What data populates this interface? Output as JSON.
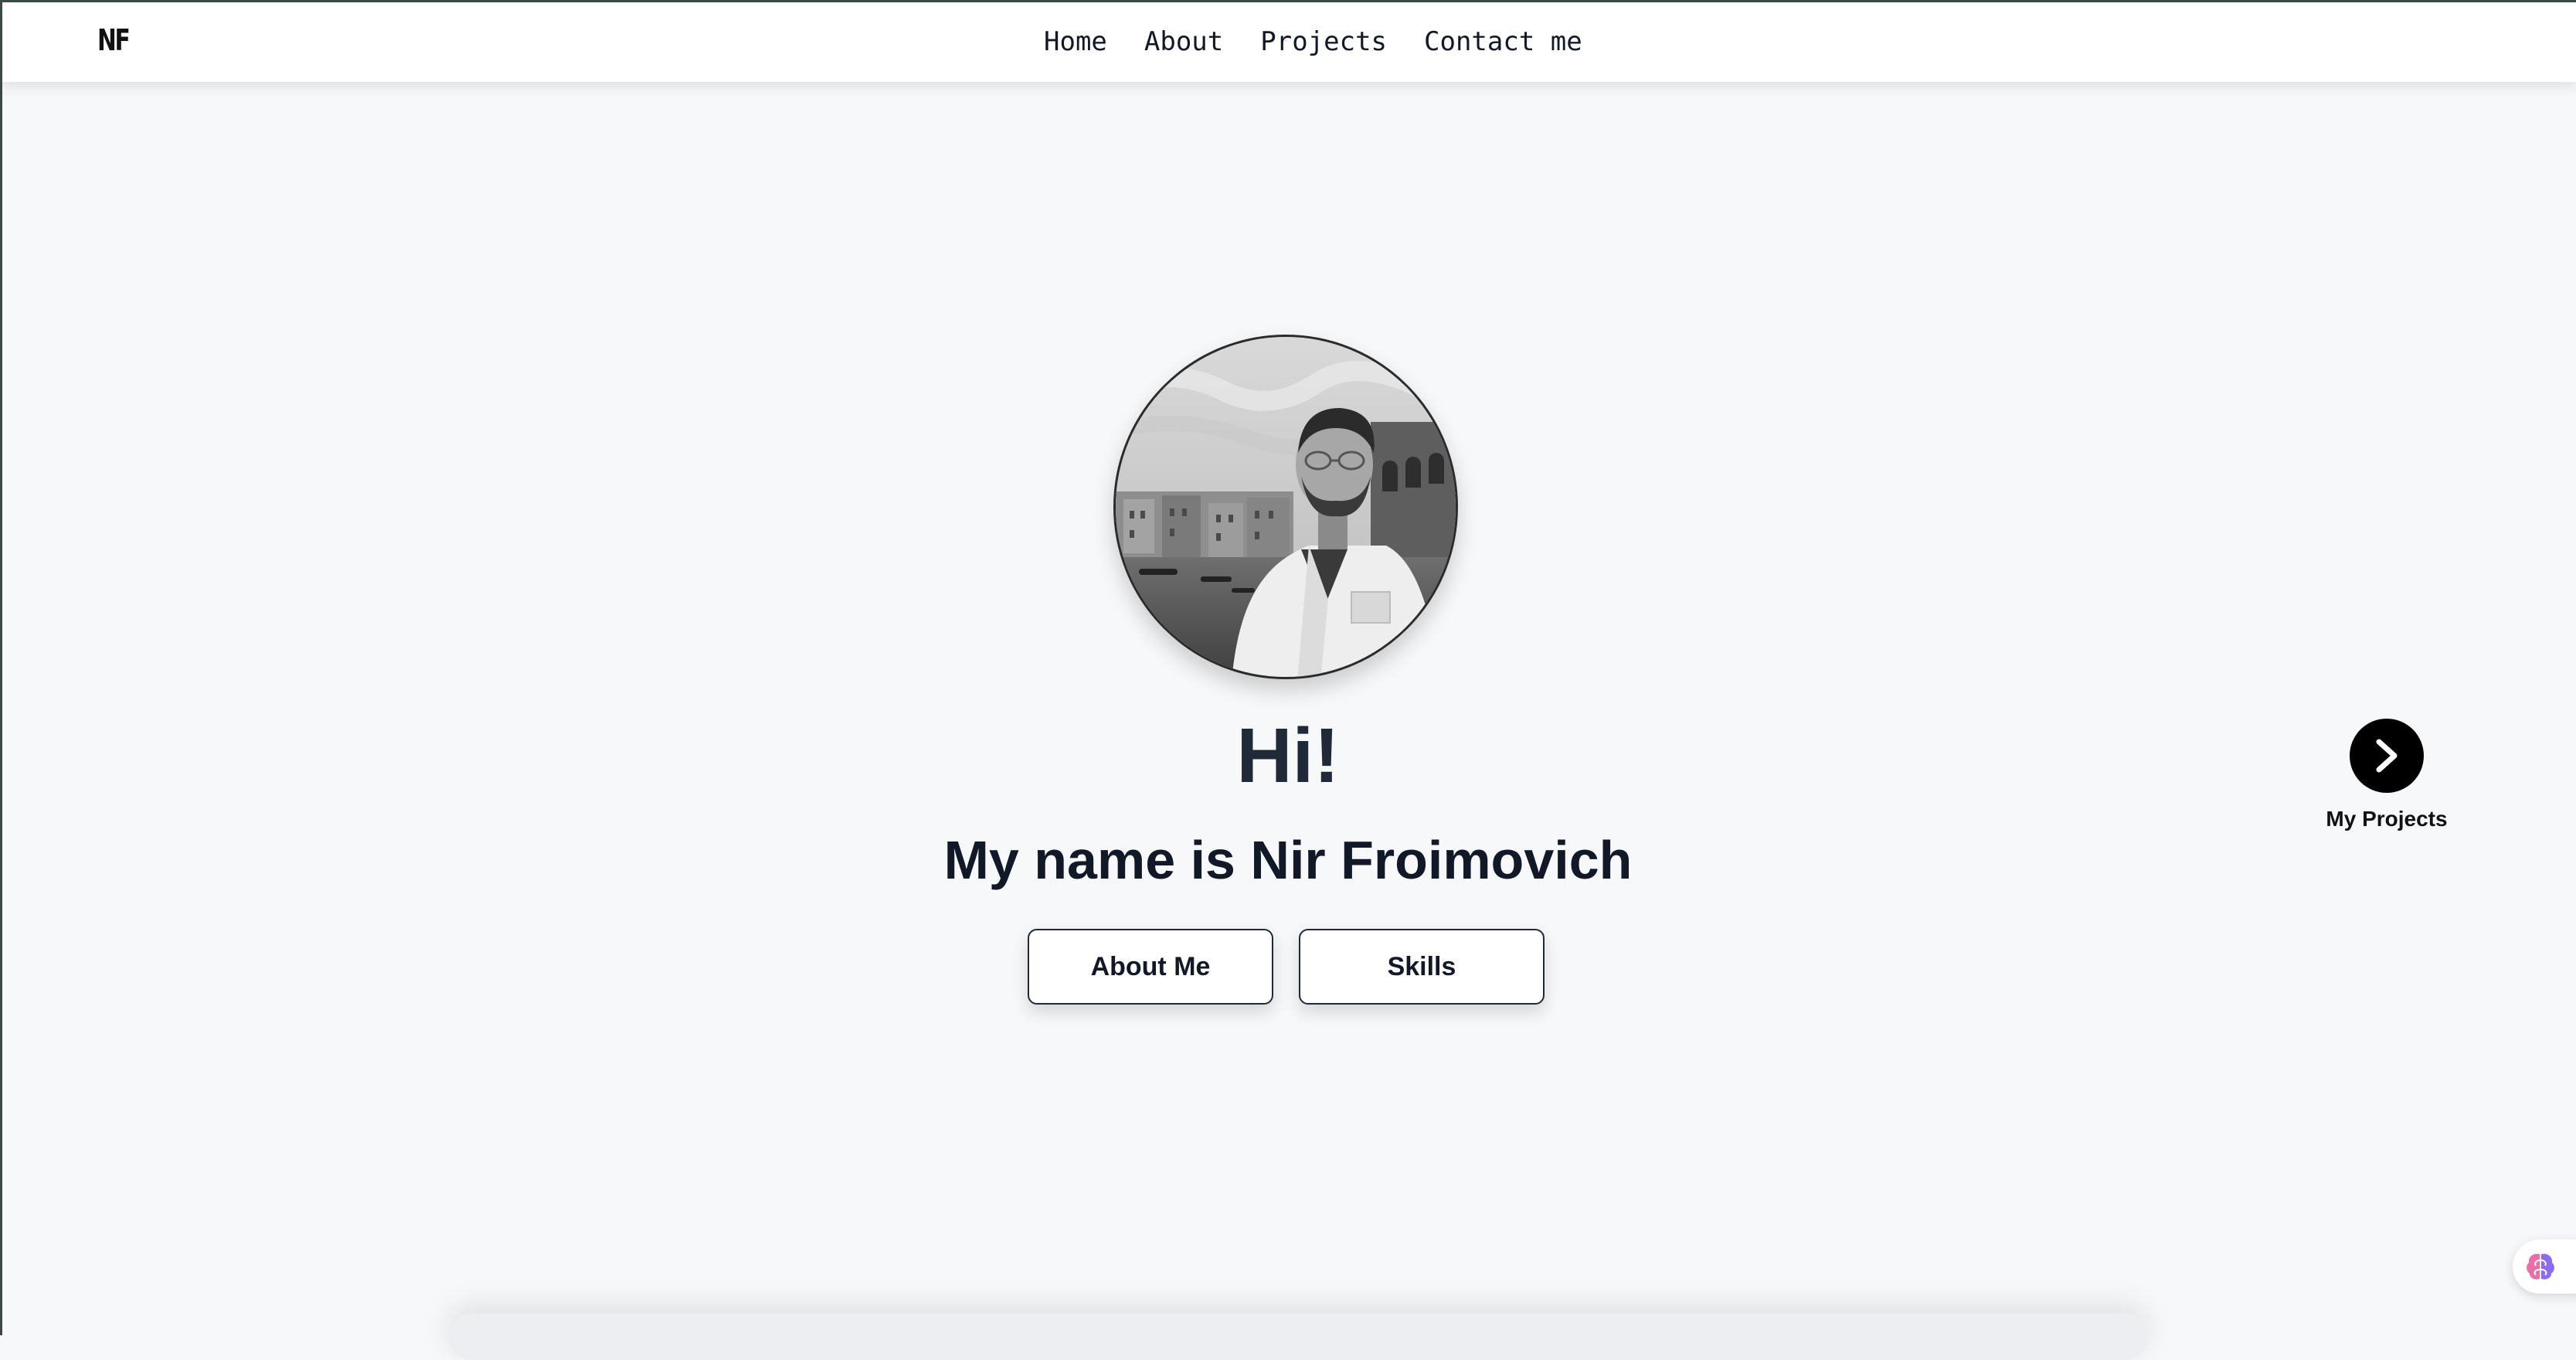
{
  "colors": {
    "background": "#f7f8fa",
    "navbar": "#ffffff",
    "text_primary": "#111827",
    "heading": "#1f2937",
    "next_button": "#000000"
  },
  "header": {
    "logo": "NF",
    "nav": [
      {
        "label": "Home"
      },
      {
        "label": "About"
      },
      {
        "label": "Projects"
      },
      {
        "label": "Contact me"
      }
    ]
  },
  "hero": {
    "avatar_icon": "profile-photo",
    "greeting": "Hi!",
    "intro": "My name is Nir Froimovich",
    "buttons": {
      "about": "About Me",
      "skills": "Skills"
    }
  },
  "side_nav": {
    "icon": "chevron-right-icon",
    "label": "My Projects"
  },
  "widget": {
    "icon": "brain-icon"
  }
}
